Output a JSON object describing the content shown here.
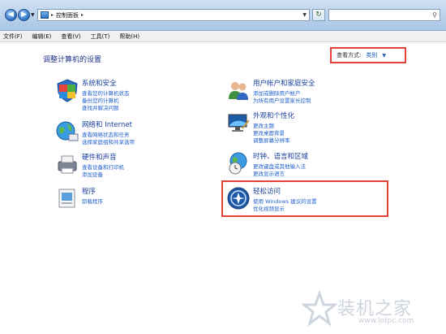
{
  "address_bar": {
    "crumb": "控制面板",
    "search_placeholder": ""
  },
  "menu": [
    "文件(F)",
    "编辑(E)",
    "查看(V)",
    "工具(T)",
    "帮助(H)"
  ],
  "heading": "调整计算机的设置",
  "view_by": {
    "label": "查看方式:",
    "value": "类别"
  },
  "categories": [
    {
      "id": "system-security",
      "title": "系统和安全",
      "links": [
        "查看您的计算机状态",
        "备份您的计算机",
        "查找并解决问题"
      ]
    },
    {
      "id": "network-internet",
      "title": "网络和 Internet",
      "links": [
        "查看网络状态和任务",
        "选择家庭组和共享选项"
      ]
    },
    {
      "id": "hardware-sound",
      "title": "硬件和声音",
      "links": [
        "查看设备和打印机",
        "添加设备"
      ]
    },
    {
      "id": "programs",
      "title": "程序",
      "links": [
        "卸载程序"
      ]
    },
    {
      "id": "user-accounts",
      "title": "用户帐户和家庭安全",
      "links": [
        "添加或删除用户帐户",
        "为所有用户设置家长控制"
      ]
    },
    {
      "id": "appearance",
      "title": "外观和个性化",
      "links": [
        "更改主题",
        "更改桌面背景",
        "调整屏幕分辨率"
      ]
    },
    {
      "id": "clock-language",
      "title": "时钟、语言和区域",
      "links": [
        "更改键盘或其他输入法",
        "更改显示语言"
      ]
    },
    {
      "id": "ease-of-access",
      "title": "轻松访问",
      "links": [
        "使用 Windows 建议的设置",
        "优化视频显示"
      ]
    }
  ],
  "watermark": {
    "brand": "装机之家",
    "url": "www.lotpc.com"
  },
  "colors": {
    "highlight": "#e3403a",
    "link": "#1f5fcc",
    "title": "#1a3fa0"
  }
}
